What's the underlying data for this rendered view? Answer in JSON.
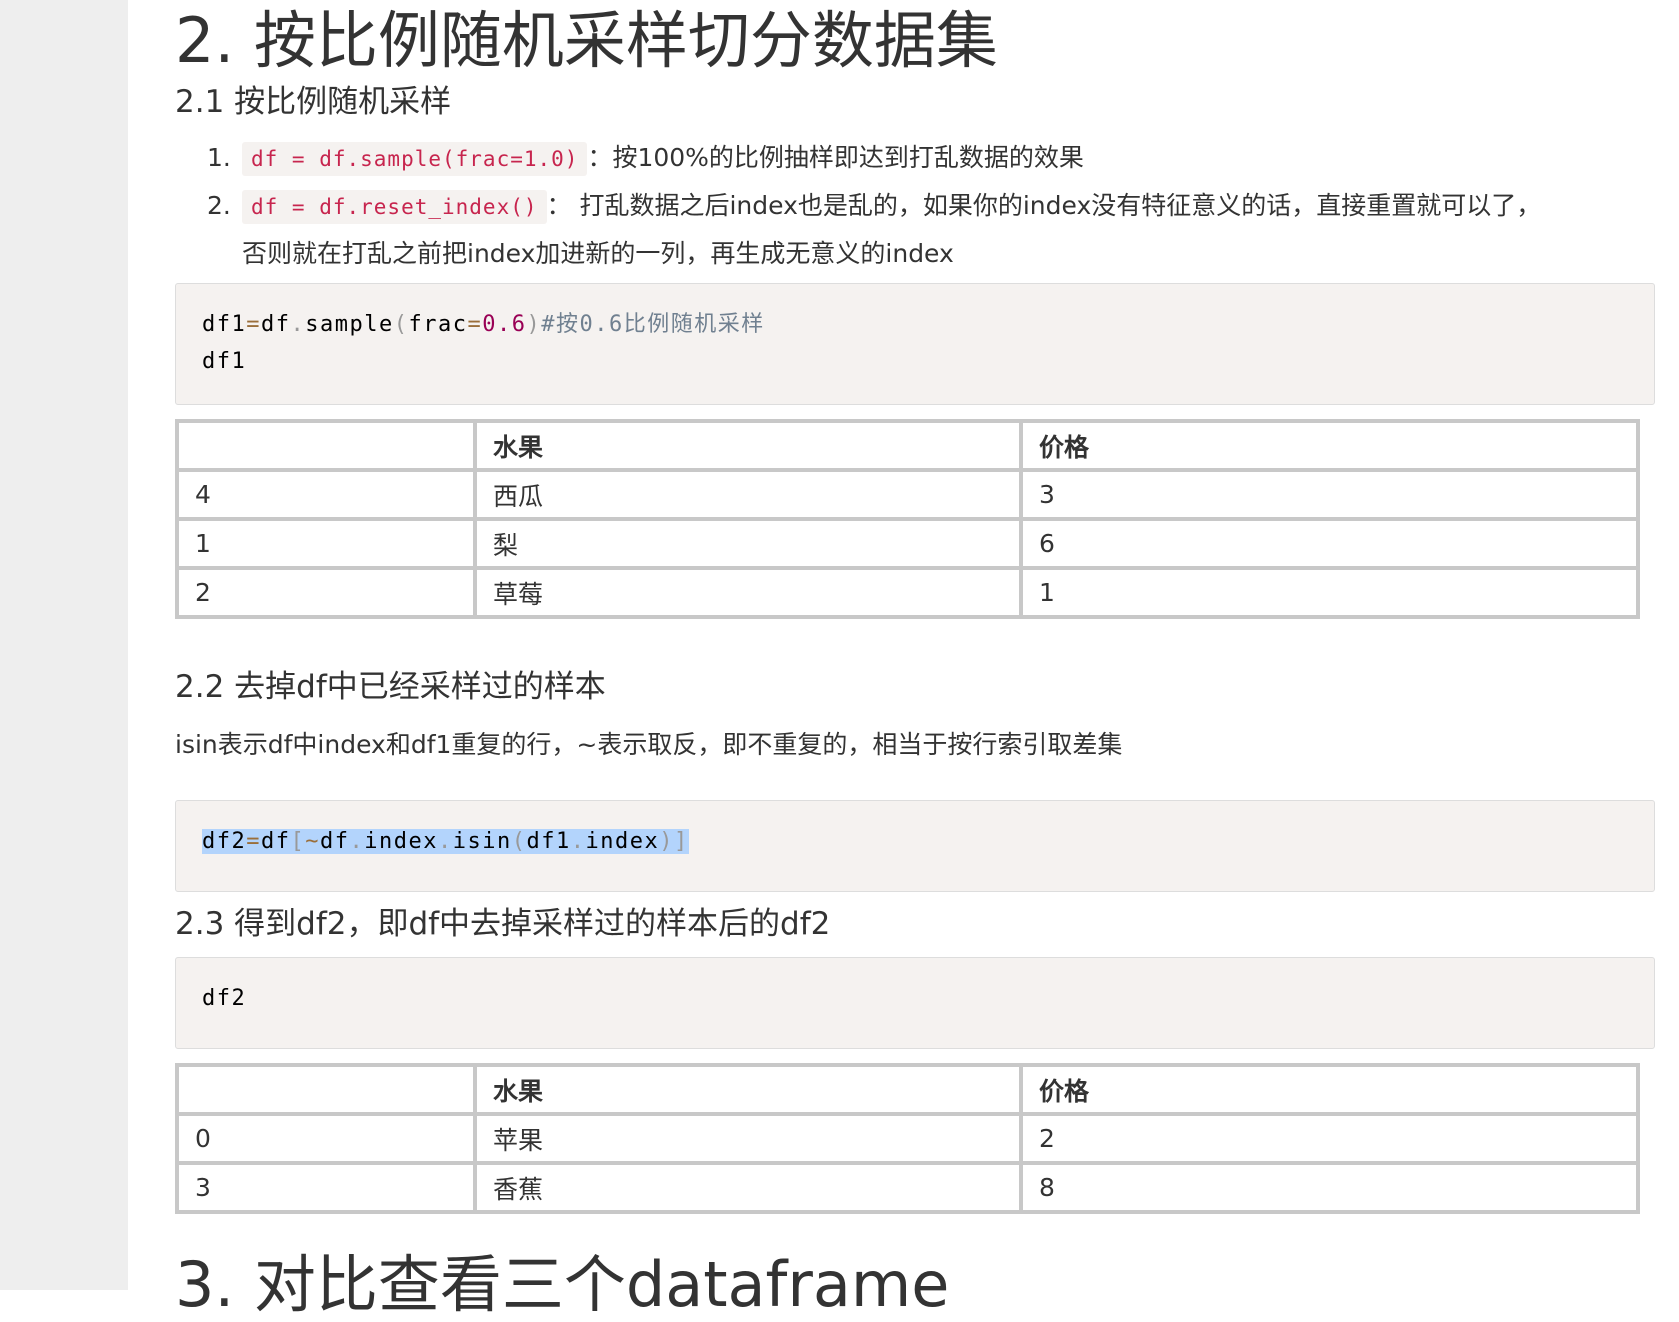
{
  "section2": {
    "title": "2. 按比例随机采样切分数据集",
    "sub1": {
      "title": "2.1 按比例随机采样",
      "steps": [
        {
          "num": "1.",
          "code": "df = df.sample(frac=1.0)",
          "text": "：按100%的比例抽样即达到打乱数据的效果"
        },
        {
          "num": "2.",
          "code": "df = df.reset_index()",
          "text": "： 打乱数据之后index也是乱的，如果你的index没有特征意义的话，直接重置就可以了，",
          "text2": "否则就在打乱之前把index加进新的一列，再生成无意义的index"
        }
      ],
      "code": {
        "line1_var": "df1",
        "line1_eq": "=",
        "line1_obj": "df",
        "line1_dot": ".",
        "line1_fn": "sample",
        "line1_lp": "(",
        "line1_arg": "frac",
        "line1_eq2": "=",
        "line1_num": "0.6",
        "line1_rp": ")",
        "line1_comment": "#按0.6比例随机采样",
        "line2": "df1"
      },
      "table": {
        "headers": [
          "",
          "水果",
          "价格"
        ],
        "rows": [
          [
            "4",
            "西瓜",
            "3"
          ],
          [
            "1",
            "梨",
            "6"
          ],
          [
            "2",
            "草莓",
            "1"
          ]
        ]
      }
    },
    "sub2": {
      "title": "2.2 去掉df中已经采样过的样本",
      "desc": "isin表示df中index和df1重复的行，~表示取反，即不重复的，相当于按行索引取差集",
      "code": {
        "var": "df2",
        "eq": "=",
        "obj": "df",
        "lb": "[",
        "tilde": "~",
        "obj2": "df",
        "dot1": ".",
        "attr1": "index",
        "dot2": ".",
        "fn": "isin",
        "lp": "(",
        "arg": "df1",
        "dot3": ".",
        "attr2": "index",
        "rp": ")",
        "rb": "]"
      }
    },
    "sub3": {
      "title": "2.3 得到df2，即df中去掉采样过的样本后的df2",
      "code": "df2",
      "table": {
        "headers": [
          "",
          "水果",
          "价格"
        ],
        "rows": [
          [
            "0",
            "苹果",
            "2"
          ],
          [
            "3",
            "香蕉",
            "8"
          ]
        ]
      }
    }
  },
  "section3": {
    "title": "3. 对比查看三个dataframe"
  }
}
